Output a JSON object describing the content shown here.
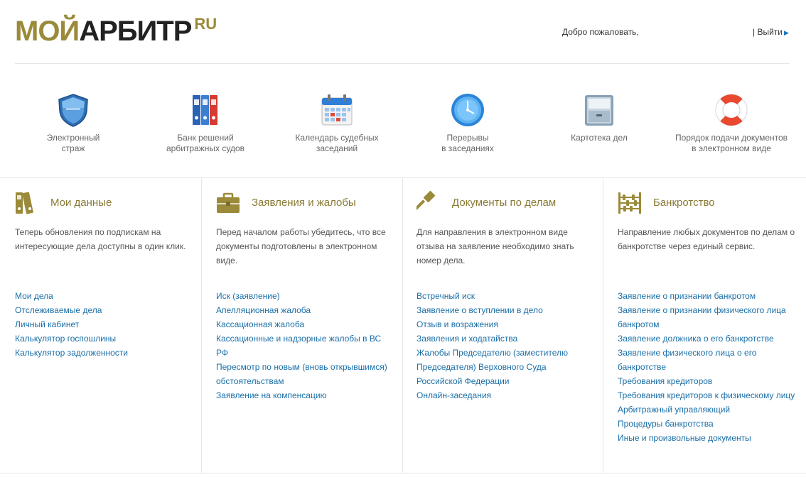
{
  "header": {
    "logo_part1": "МОЙ",
    "logo_part2": "АРБИТР",
    "logo_part3": "RU",
    "welcome": "Добро пожаловать,",
    "logout": "| Выйти"
  },
  "services": [
    {
      "icon": "shield-icon",
      "label": "Электронный\nстраж"
    },
    {
      "icon": "binders-icon",
      "label": "Банк решений\nарбитражных судов"
    },
    {
      "icon": "calendar-icon",
      "label": "Календарь судебных\nзаседаний"
    },
    {
      "icon": "clock-icon",
      "label": "Перерывы\nв заседаниях"
    },
    {
      "icon": "file-cabinet-icon",
      "label": "Картотека дел"
    },
    {
      "icon": "lifebuoy-icon",
      "label": "Порядок подачи документов\nв электронном виде"
    }
  ],
  "columns": [
    {
      "title": "Мои данные",
      "icon": "folders-icon",
      "desc": "Теперь обновления по подпискам на интересующие дела доступны в один клик.",
      "links": [
        "Мои дела",
        "Отслеживаемые дела",
        "Личный кабинет",
        "Калькулятор госпошлины",
        "Калькулятор задолженности"
      ]
    },
    {
      "title": "Заявления и жалобы",
      "icon": "briefcase-icon",
      "desc": "Перед началом работы убедитесь, что все документы подготовлены в электронном виде.",
      "links": [
        "Иск (заявление)",
        "Апелляционная жалоба",
        "Кассационная жалоба",
        "Кассационные и надзорные жалобы в ВС РФ",
        "Пересмотр по новым (вновь открывшимся) обстоятельствам",
        "Заявление на компенсацию"
      ]
    },
    {
      "title": "Документы по делам",
      "icon": "gavel-icon",
      "desc": "Для направления в электронном виде отзыва на заявление необходимо знать номер дела.",
      "links": [
        "Встречный иск",
        "Заявление о вступлении в дело",
        "Отзыв и возражения",
        "Заявления и ходатайства",
        "Жалобы Председателю (заместителю Председателя) Верховного Суда Российской Федерации",
        "Онлайн-заседания"
      ]
    },
    {
      "title": "Банкротство",
      "icon": "abacus-icon",
      "desc": "Направление любых документов по делам о банкротстве через единый сервис.",
      "links": [
        "Заявление о признании банкротом",
        "Заявление о признании физического лица банкротом",
        "Заявление должника о его банкротстве",
        "Заявление физического лица о его банкротстве",
        "Требования кредиторов",
        "Требования кредиторов к физическому лицу",
        "Арбитражный управляющий",
        "Процедуры банкротства",
        "Иные и произвольные документы"
      ]
    }
  ],
  "colors": {
    "accent_gold": "#9b8a3a",
    "link_blue": "#1a6fa8",
    "title_gold": "#8a7a35"
  }
}
